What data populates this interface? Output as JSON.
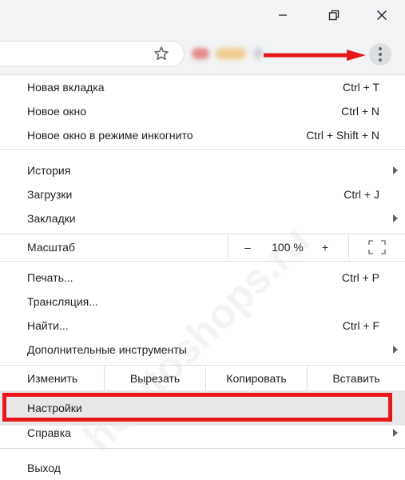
{
  "window": {
    "minimize_icon": "minimize-icon",
    "restore_icon": "restore-icon",
    "close_icon": "close-icon"
  },
  "toolbar": {
    "bookmark_icon": "star-icon",
    "menu_icon": "three-dots-vertical-icon"
  },
  "annotation": {
    "arrow_color": "#e8171c",
    "highlight_color": "#e8171c"
  },
  "menu": {
    "new_tab": {
      "label": "Новая вкладка",
      "shortcut": "Ctrl + T"
    },
    "new_window": {
      "label": "Новое окно",
      "shortcut": "Ctrl + N"
    },
    "incognito": {
      "label": "Новое окно в режиме инкогнито",
      "shortcut": "Ctrl + Shift + N"
    },
    "history": {
      "label": "История"
    },
    "downloads": {
      "label": "Загрузки",
      "shortcut": "Ctrl + J"
    },
    "bookmarks": {
      "label": "Закладки"
    },
    "zoom": {
      "label": "Масштаб",
      "minus": "–",
      "value": "100 %",
      "plus": "+",
      "fullscreen_icon": "fullscreen-icon"
    },
    "print": {
      "label": "Печать...",
      "shortcut": "Ctrl + P"
    },
    "cast": {
      "label": "Трансляция..."
    },
    "find": {
      "label": "Найти...",
      "shortcut": "Ctrl + F"
    },
    "more_tools": {
      "label": "Дополнительные инструменты"
    },
    "edit": {
      "label": "Изменить",
      "cut": "Вырезать",
      "copy": "Копировать",
      "paste": "Вставить"
    },
    "settings": {
      "label": "Настройки"
    },
    "help": {
      "label": "Справка"
    },
    "exit": {
      "label": "Выход"
    }
  }
}
